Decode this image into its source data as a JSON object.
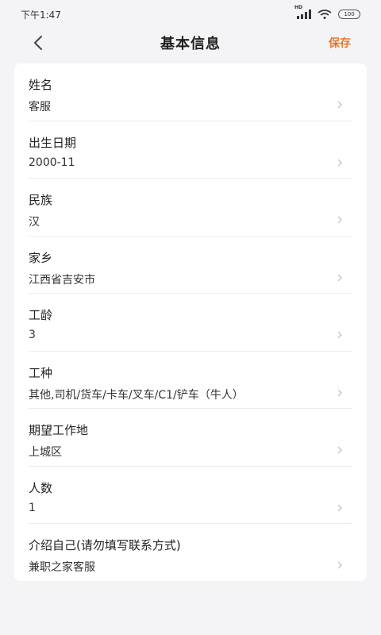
{
  "status": {
    "time": "下午1:47",
    "hd": "HD",
    "battery": "100"
  },
  "nav": {
    "title": "基本信息",
    "save_label": "保存"
  },
  "fields": [
    {
      "label": "姓名",
      "value": "客服"
    },
    {
      "label": "出生日期",
      "value": "2000-11"
    },
    {
      "label": "民族",
      "value": "汉"
    },
    {
      "label": "家乡",
      "value": "江西省吉安市"
    },
    {
      "label": "工龄",
      "value": "3"
    },
    {
      "label": "工种",
      "value": "其他,司机/货车/卡车/叉车/C1/铲车（牛人）"
    },
    {
      "label": "期望工作地",
      "value": "上城区"
    },
    {
      "label": "人数",
      "value": "1"
    },
    {
      "label": "介绍自己(请勿填写联系方式)",
      "value": "兼职之家客服"
    }
  ],
  "colors": {
    "accent": "#e8762c",
    "background": "#f4f4f6",
    "card": "#ffffff"
  },
  "icons": {
    "back": "chevron-left-icon",
    "row": "chevron-right-icon"
  }
}
